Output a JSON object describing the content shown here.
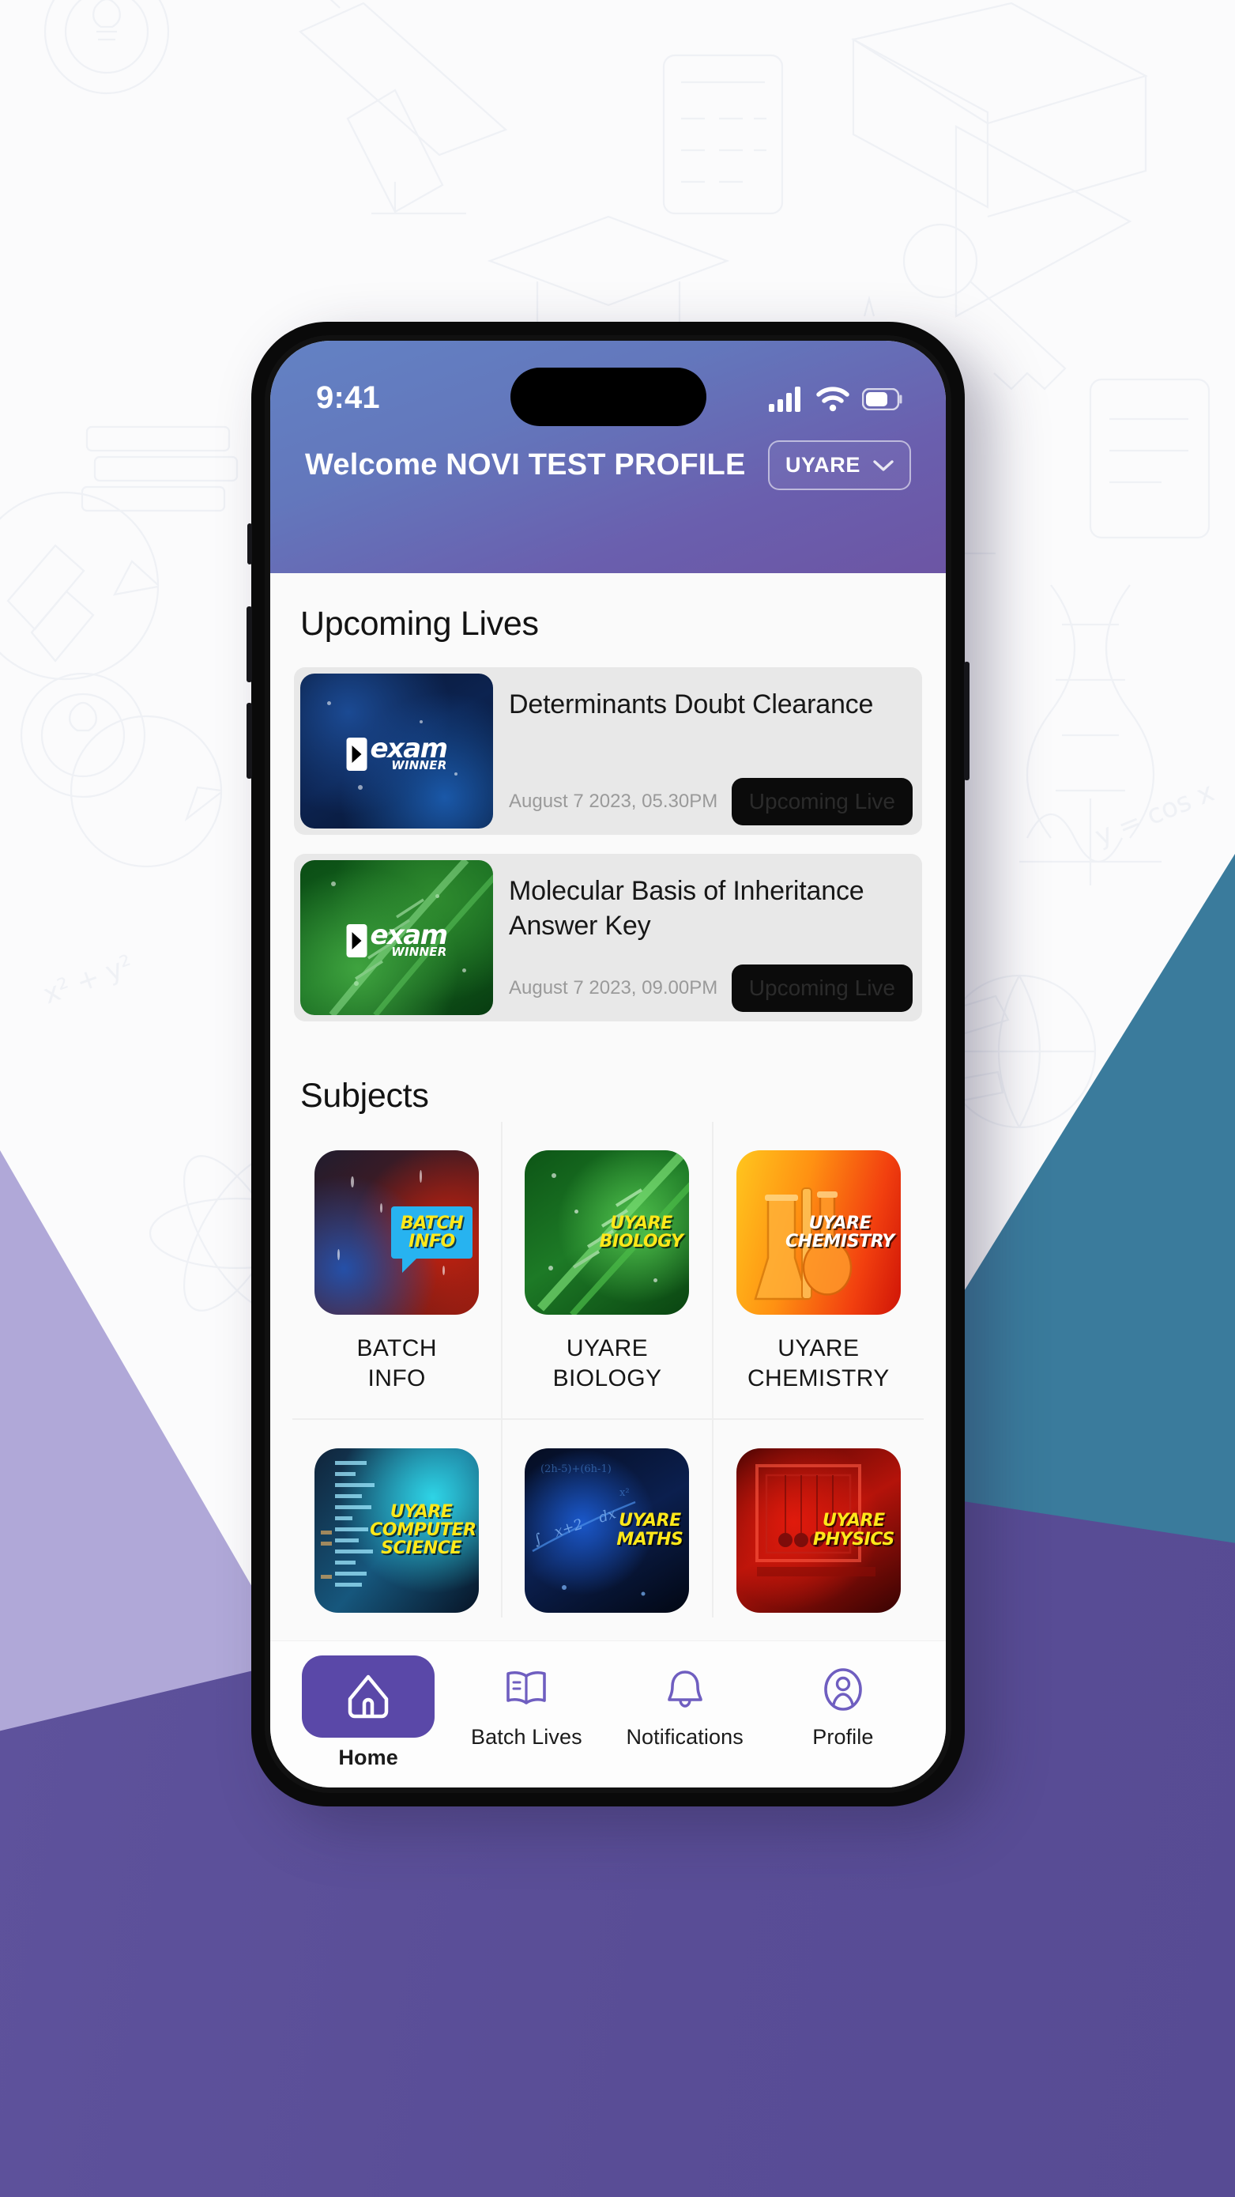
{
  "theme": {
    "header_gradient_start": "#6382c4",
    "header_gradient_end": "#6c55a4",
    "accent_purple": "#5a48a8",
    "backdrop_purple": "#594d96",
    "backdrop_lilac": "#b0a8d8",
    "backdrop_teal": "#3a7b9c",
    "badge_black": "#0b0b0b"
  },
  "status_bar": {
    "time": "9:41",
    "signal_icon": "cellular-signal-icon",
    "wifi_icon": "wifi-icon",
    "battery_icon": "battery-icon"
  },
  "header": {
    "welcome": "Welcome NOVI TEST PROFILE",
    "batch_selector": {
      "value": "UYARE",
      "chevron_icon": "chevron-down-icon"
    }
  },
  "upcoming": {
    "title": "Upcoming Lives",
    "items": [
      {
        "title": "Determinants Doubt Clearance",
        "time": "August 7 2023, 05.30PM",
        "badge": "Upcoming Live",
        "thumb_style": "thumb-math",
        "logo_main": "exam",
        "logo_sub": "WINNER"
      },
      {
        "title": "Molecular Basis of Inheritance Answer Key",
        "time": "August 7 2023, 09.00PM",
        "badge": "Upcoming Live",
        "thumb_style": "thumb-bio",
        "logo_main": "exam",
        "logo_sub": "WINNER"
      }
    ]
  },
  "subjects": {
    "title": "Subjects",
    "items": [
      {
        "label": "BATCH\nINFO",
        "badge_line1": "BATCH",
        "badge_line2": "INFO",
        "badge_color": "badge-yellow",
        "thumb_style": "th-batch"
      },
      {
        "label": "UYARE\nBIOLOGY",
        "badge_line1": "UYARE",
        "badge_line2": "BIOLOGY",
        "badge_color": "badge-yellow",
        "thumb_style": "th-bio"
      },
      {
        "label": "UYARE\nCHEMISTRY",
        "badge_line1": "UYARE",
        "badge_line2": "CHEMISTRY",
        "badge_color": "badge-white",
        "thumb_style": "th-chem"
      },
      {
        "label": "",
        "badge_line1": "UYARE",
        "badge_line2": "COMPUTER SCIENCE",
        "badge_color": "badge-yellow",
        "thumb_style": "th-cs"
      },
      {
        "label": "",
        "badge_line1": "UYARE",
        "badge_line2": "MATHS",
        "badge_color": "badge-yellow",
        "thumb_style": "th-maths"
      },
      {
        "label": "",
        "badge_line1": "UYARE",
        "badge_line2": "PHYSICS",
        "badge_color": "badge-yellow",
        "thumb_style": "th-phys"
      }
    ]
  },
  "bottom_nav": {
    "items": [
      {
        "label": "Home",
        "icon": "home-icon",
        "active": true
      },
      {
        "label": "Batch Lives",
        "icon": "book-icon",
        "active": false
      },
      {
        "label": "Notifications",
        "icon": "bell-icon",
        "active": false
      },
      {
        "label": "Profile",
        "icon": "user-circle-icon",
        "active": false
      }
    ]
  }
}
